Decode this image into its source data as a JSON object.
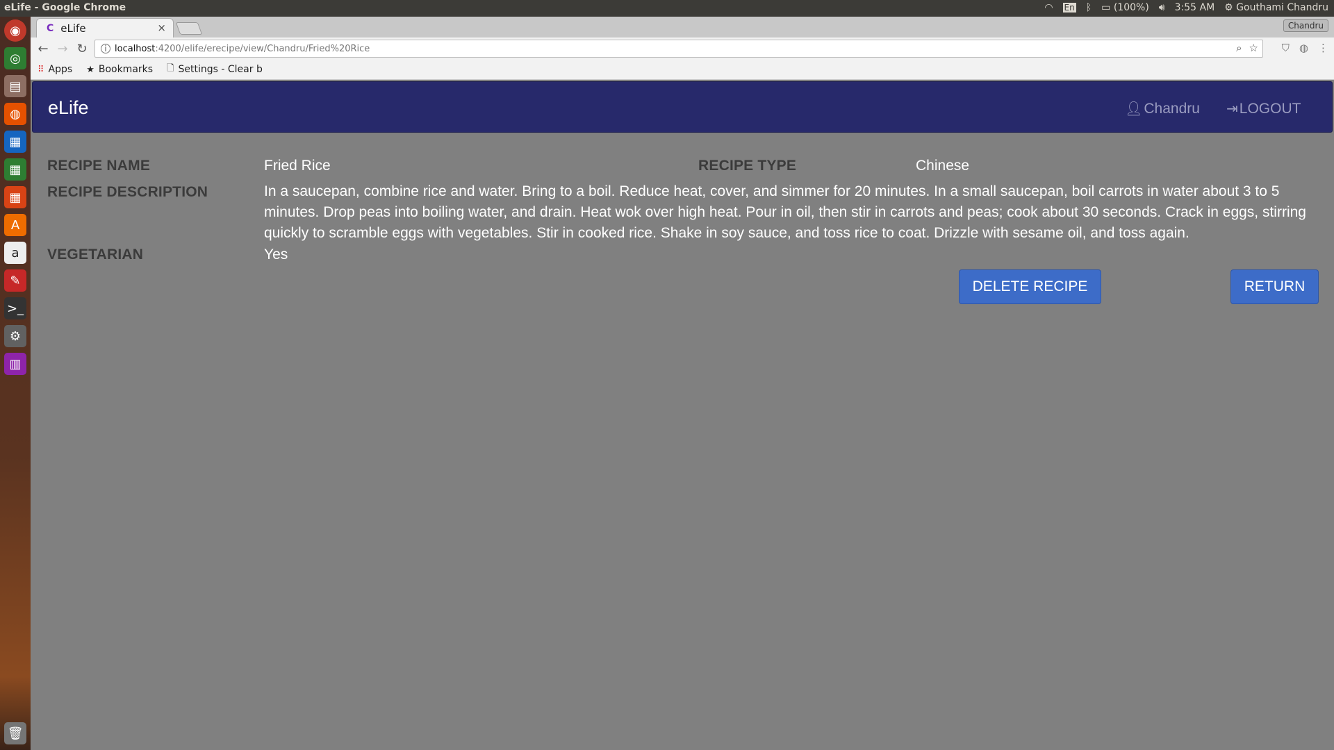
{
  "system": {
    "window_title": "eLife - Google Chrome",
    "keyboard": "En",
    "battery": "(100%)",
    "clock": "3:55 AM",
    "user": "Gouthami Chandru"
  },
  "browser": {
    "tab_title": "eLife",
    "tab_favicon": "C",
    "profile": "Chandru",
    "url_host": "localhost",
    "url_path": ":4200/elife/erecipe/view/Chandru/Fried%20Rice",
    "bookmarks": [
      {
        "icon": "apps-grid-icon",
        "label": "Apps"
      },
      {
        "icon": "star-icon",
        "label": "Bookmarks"
      },
      {
        "icon": "page-icon",
        "label": "Settings - Clear b"
      }
    ]
  },
  "app": {
    "brand": "eLife",
    "user_link": "Chandru",
    "logout_link": "LOGOUT",
    "accent": "#27296b",
    "button_color": "#3d6cc8"
  },
  "recipe": {
    "name_label": "RECIPE NAME",
    "name": "Fried Rice",
    "type_label": "RECIPE TYPE",
    "type": "Chinese",
    "description_label": "RECIPE DESCRIPTION",
    "description": "In a saucepan, combine rice and water. Bring to a boil. Reduce heat, cover, and simmer for 20 minutes. In a small saucepan, boil carrots in water about 3 to 5 minutes. Drop peas into boiling water, and drain. Heat wok over high heat. Pour in oil, then stir in carrots and peas; cook about 30 seconds. Crack in eggs, stirring quickly to scramble eggs with vegetables. Stir in cooked rice. Shake in soy sauce, and toss rice to coat. Drizzle with sesame oil, and toss again.",
    "vegetarian_label": "VEGETARIAN",
    "vegetarian": "Yes"
  },
  "actions": {
    "delete_label": "DELETE RECIPE",
    "return_label": "RETURN"
  }
}
